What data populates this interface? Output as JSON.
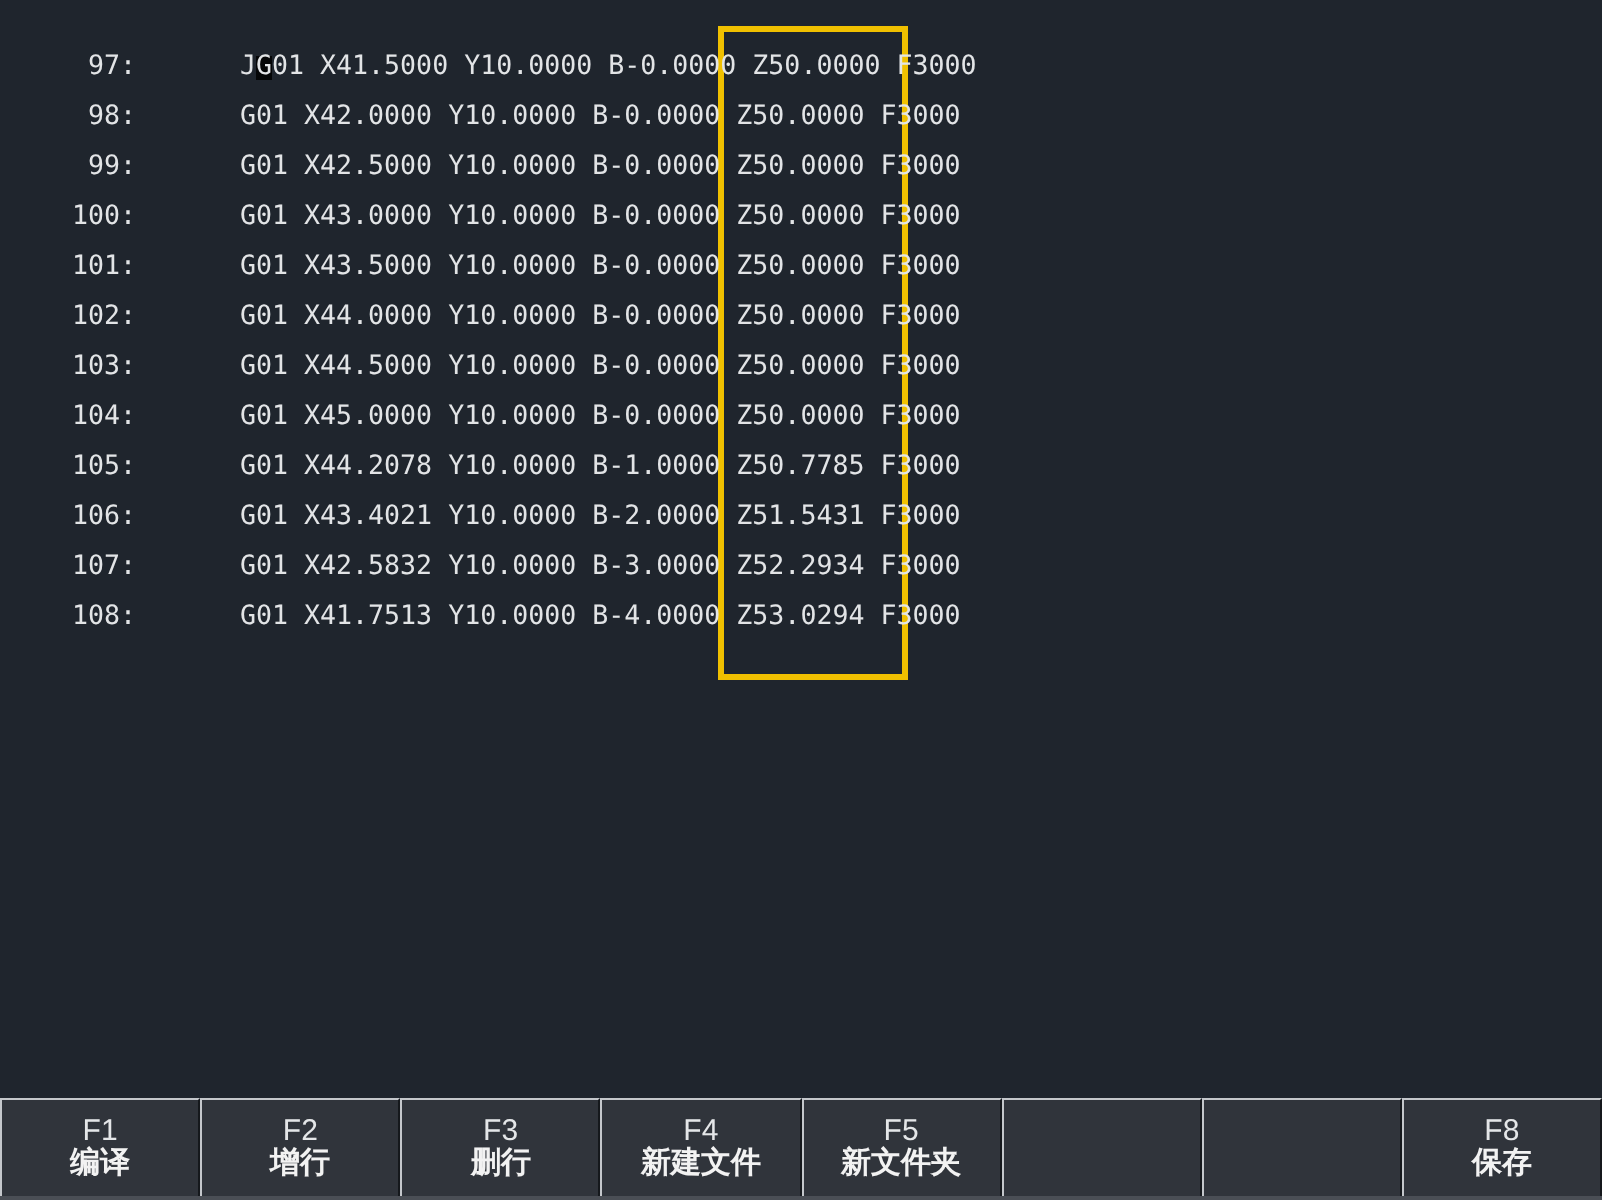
{
  "program_lines": [
    {
      "number": "97:",
      "code": "JG01 X41.5000 Y10.0000 B-0.0000 Z50.0000 F3000",
      "cursor": true
    },
    {
      "number": "98:",
      "code": "G01 X42.0000 Y10.0000 B-0.0000 Z50.0000 F3000",
      "cursor": false
    },
    {
      "number": "99:",
      "code": "G01 X42.5000 Y10.0000 B-0.0000 Z50.0000 F3000",
      "cursor": false
    },
    {
      "number": "100:",
      "code": "G01 X43.0000 Y10.0000 B-0.0000 Z50.0000 F3000",
      "cursor": false
    },
    {
      "number": "101:",
      "code": "G01 X43.5000 Y10.0000 B-0.0000 Z50.0000 F3000",
      "cursor": false
    },
    {
      "number": "102:",
      "code": "G01 X44.0000 Y10.0000 B-0.0000 Z50.0000 F3000",
      "cursor": false
    },
    {
      "number": "103:",
      "code": "G01 X44.5000 Y10.0000 B-0.0000 Z50.0000 F3000",
      "cursor": false
    },
    {
      "number": "104:",
      "code": "G01 X45.0000 Y10.0000 B-0.0000 Z50.0000 F3000",
      "cursor": false
    },
    {
      "number": "105:",
      "code": "G01 X44.2078 Y10.0000 B-1.0000 Z50.7785 F3000",
      "cursor": false
    },
    {
      "number": "106:",
      "code": "G01 X43.4021 Y10.0000 B-2.0000 Z51.5431 F3000",
      "cursor": false
    },
    {
      "number": "107:",
      "code": "G01 X42.5832 Y10.0000 B-3.0000 Z52.2934 F3000",
      "cursor": false
    },
    {
      "number": "108:",
      "code": "G01 X41.7513 Y10.0000 B-4.0000 Z53.0294 F3000",
      "cursor": false
    }
  ],
  "highlight_frame": true,
  "softkeys": [
    {
      "kind": "function",
      "key": "F1",
      "label": "编译"
    },
    {
      "kind": "function",
      "key": "F2",
      "label": "增行"
    },
    {
      "kind": "function",
      "key": "F3",
      "label": "删行"
    },
    {
      "kind": "function",
      "key": "F4",
      "label": "新建文件"
    },
    {
      "kind": "function",
      "key": "F5",
      "label": "新文件夹"
    },
    {
      "kind": "blank"
    },
    {
      "kind": "blank"
    },
    {
      "kind": "function",
      "key": "F8",
      "label": "保存"
    }
  ]
}
